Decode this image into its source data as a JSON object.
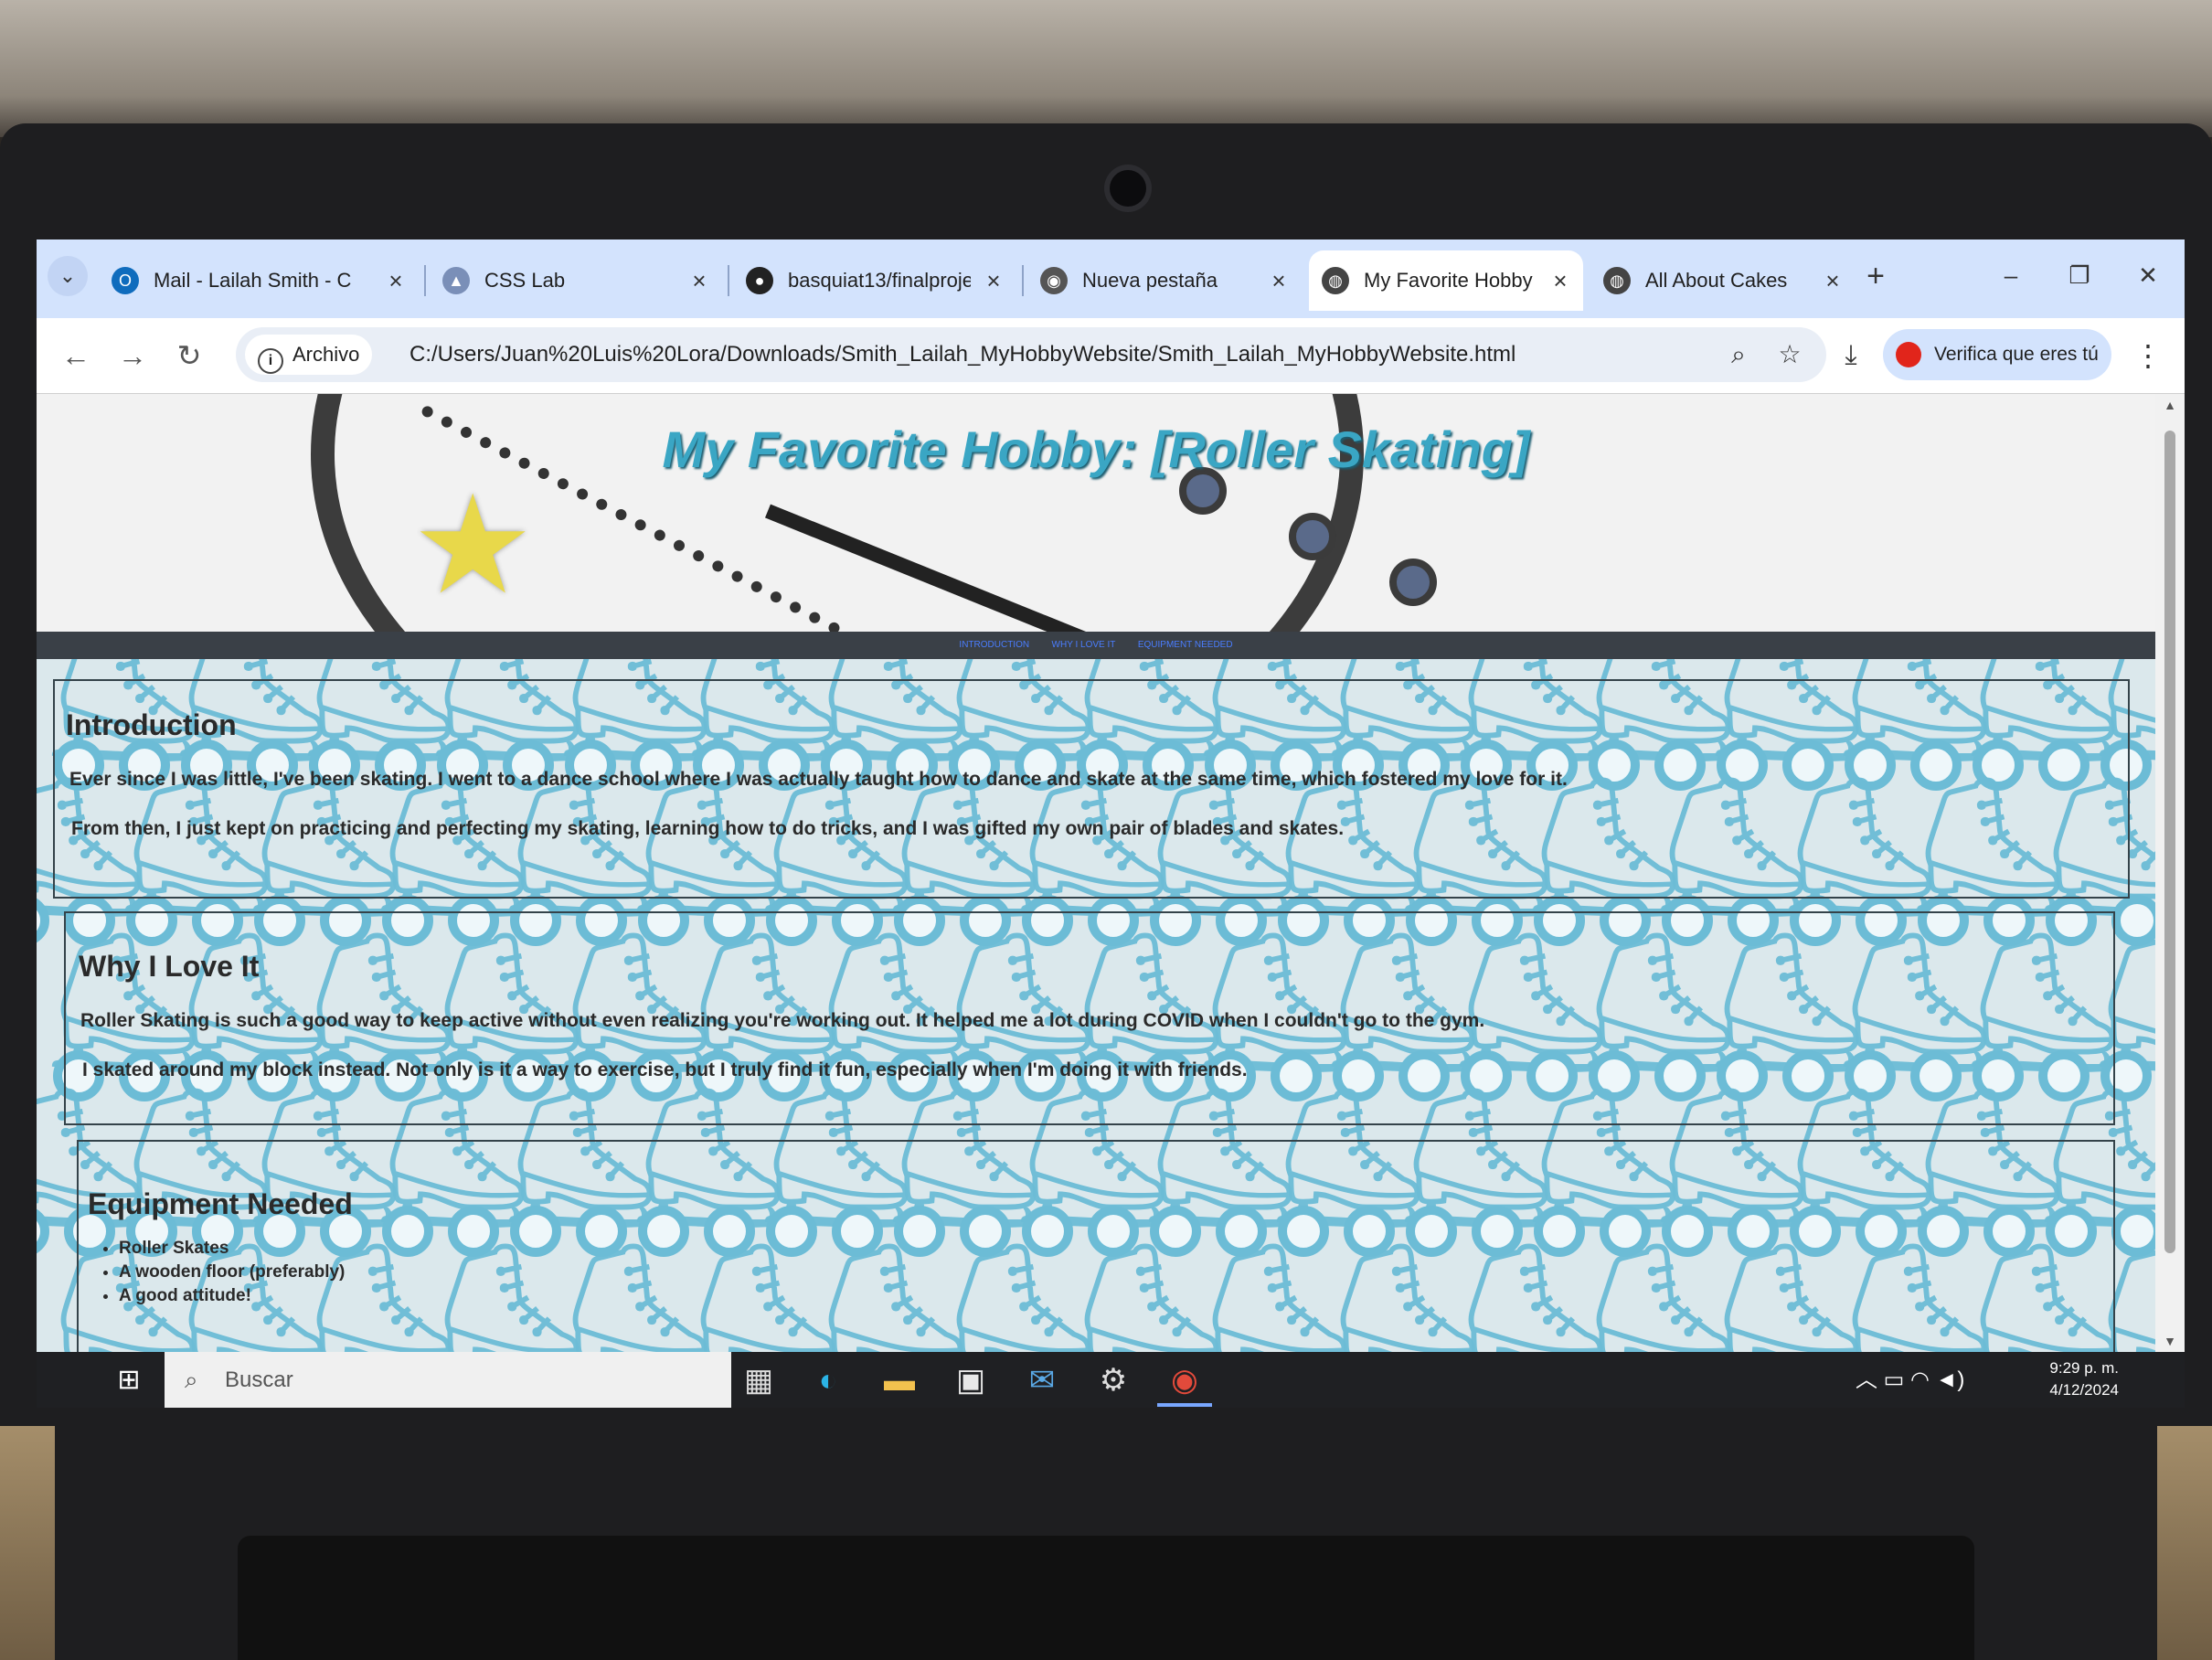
{
  "browser": {
    "tabs": [
      {
        "label": "Mail - Lailah Smith - C",
        "icon": "outlook-icon",
        "active": false
      },
      {
        "label": "CSS Lab",
        "icon": "course-icon",
        "active": false
      },
      {
        "label": "basquiat13/finalproje",
        "icon": "github-icon",
        "active": false
      },
      {
        "label": "Nueva pestaña",
        "icon": "chrome-icon",
        "active": false
      },
      {
        "label": "My Favorite Hobby",
        "icon": "globe-icon",
        "active": true
      },
      {
        "label": "All About Cakes",
        "icon": "globe-icon",
        "active": false
      }
    ],
    "site_chip": "Archivo",
    "url": "C:/Users/Juan%20Luis%20Lora/Downloads/Smith_Lailah_MyHobbyWebsite/Smith_Lailah_MyHobbyWebsite.html",
    "verify_label": "Verifica que eres tú"
  },
  "page": {
    "title": "My Favorite Hobby: [Roller Skating]",
    "nav": [
      "INTRODUCTION",
      "WHY I LOVE IT",
      "EQUIPMENT NEEDED"
    ],
    "sections": {
      "intro": {
        "heading": "Introduction",
        "p1": "Ever since I was little, I've been skating. I went to a dance school where I was actually taught how to dance and skate at the same time, which fostered my love for it.",
        "p2": "From then, I just kept on practicing and perfecting my skating, learning how to do tricks, and I was gifted my own pair of blades and skates."
      },
      "why": {
        "heading": "Why I Love It",
        "p1": "Roller Skating is such a good way to keep active without even realizing you're working out. It helped me a lot during COVID when I couldn't go to the gym.",
        "p2": "I skated around my block instead. Not only is it a way to exercise, but I truly find it fun, especially when I'm doing it with friends."
      },
      "equipment": {
        "heading": "Equipment Needed",
        "items": [
          "Roller Skates",
          "A wooden floor (preferably)",
          "A good attitude!"
        ]
      }
    }
  },
  "taskbar": {
    "search_placeholder": "Buscar",
    "time": "9:29 p. m.",
    "date": "4/12/2024"
  },
  "colors": {
    "title": "#3aa6c4",
    "skate": "#6cbcd6",
    "tabstrip": "#d3e3fd"
  }
}
